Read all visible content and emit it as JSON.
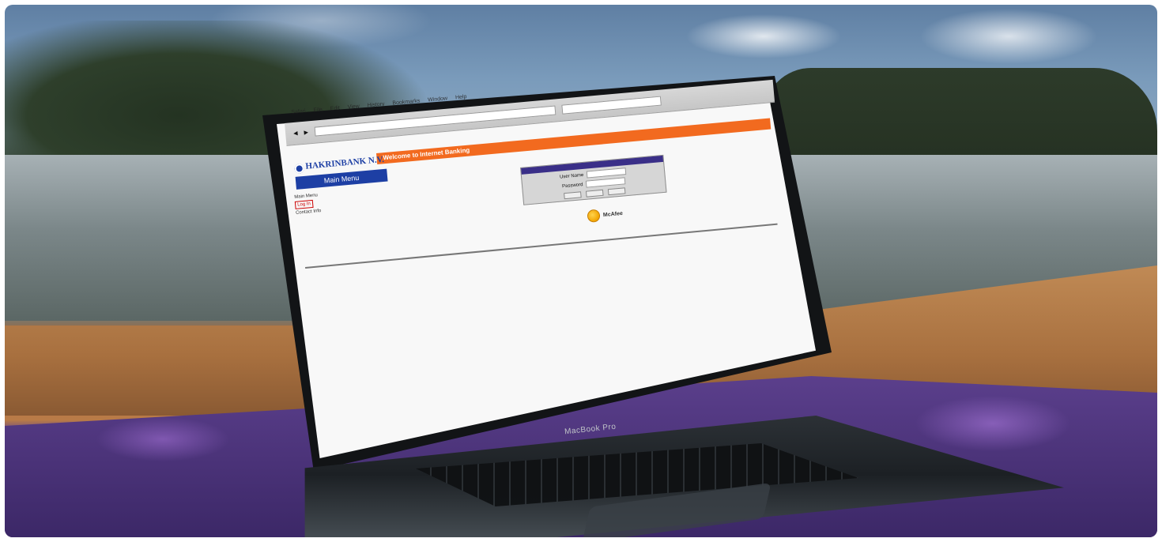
{
  "scene": {
    "device_label": "MacBook Pro"
  },
  "browser": {
    "menu_items": [
      "Safari",
      "File",
      "Edit",
      "View",
      "History",
      "Bookmarks",
      "Window",
      "Help"
    ],
    "address": "",
    "search_placeholder": ""
  },
  "site": {
    "bank_name": "HAKRINBANK N.V.",
    "main_menu": "Main Menu",
    "welcome_text": "Welcome to Internet Banking",
    "sidebar": {
      "line1": "Main Menu",
      "button1": "Log In",
      "line3": "Contact Info"
    },
    "login": {
      "header": "",
      "user_id_label": "User Name",
      "password_label": "Password",
      "buttons": [
        "",
        "",
        ""
      ]
    },
    "security_badge": "McAfee"
  }
}
